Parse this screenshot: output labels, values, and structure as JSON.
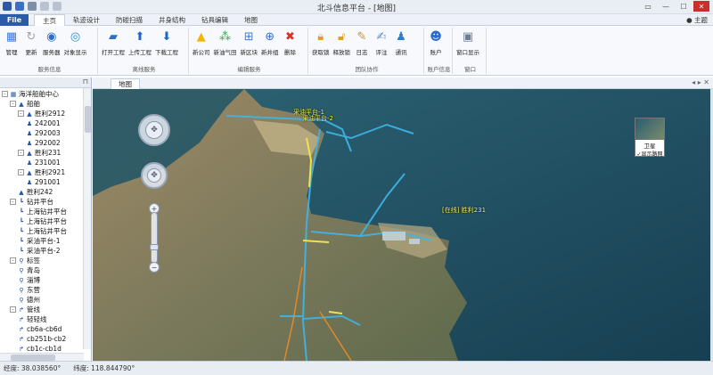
{
  "window": {
    "title": "北斗信息平台 - [地图]",
    "theme_label": "主题"
  },
  "file_tab": "File",
  "tabs": [
    "主页",
    "轨迹设计",
    "防碰扫描",
    "井身结构",
    "钻具编辑",
    "地图"
  ],
  "ribbon": {
    "groups": [
      {
        "label": "服务信息",
        "buttons": [
          "管理",
          "更新",
          "服务器",
          "对象显示"
        ]
      },
      {
        "label": "离线服务",
        "buttons": [
          "打开工程",
          "上传工程",
          "下载工程"
        ]
      },
      {
        "label": "编辑服务",
        "buttons": [
          "新公司",
          "新油气田",
          "新区块",
          "新井组",
          "删除"
        ]
      },
      {
        "label": "团队协作",
        "buttons": [
          "获取锁",
          "释放锁",
          "日志",
          "评注",
          "通讯"
        ]
      },
      {
        "label": "账户信息",
        "buttons": [
          "账户"
        ]
      },
      {
        "label": "窗口",
        "buttons": [
          "窗口显示"
        ]
      }
    ],
    "icon_colors": {
      "manage": "#3a7bd5",
      "update": "#9aa3ae",
      "server": "#2c6fc7",
      "display": "#2a8fd0",
      "open": "#2d6fc2",
      "upload": "#1f67c6",
      "download": "#1f67c6",
      "company": "#f4b400",
      "oilfield": "#2fa84f",
      "block": "#3b7dd8",
      "wellgroup": "#3b6fc4",
      "delete": "#d9302c",
      "lock": "#e1a21a",
      "unlock": "#e1a21a",
      "log": "#c8943a",
      "comment": "#5a8fd6",
      "comm": "#2a7fd4",
      "account": "#2b6ac9",
      "window": "#6c7d94"
    }
  },
  "tree": {
    "nodes": [
      {
        "label": "海洋船舶中心",
        "level": 0,
        "exp": "-",
        "icon": "grid"
      },
      {
        "label": "船舶",
        "level": 1,
        "exp": "-",
        "icon": "ship"
      },
      {
        "label": "胜利2912",
        "level": 2,
        "exp": "-",
        "icon": "ship"
      },
      {
        "label": "242001",
        "level": 3,
        "exp": "",
        "icon": "crew"
      },
      {
        "label": "292003",
        "level": 3,
        "exp": "",
        "icon": "crew"
      },
      {
        "label": "292002",
        "level": 3,
        "exp": "",
        "icon": "crew"
      },
      {
        "label": "胜利231",
        "level": 2,
        "exp": "-",
        "icon": "ship"
      },
      {
        "label": "231001",
        "level": 3,
        "exp": "",
        "icon": "crew"
      },
      {
        "label": "胜利2921",
        "level": 2,
        "exp": "-",
        "icon": "ship"
      },
      {
        "label": "291001",
        "level": 3,
        "exp": "",
        "icon": "crew"
      },
      {
        "label": "胜利242",
        "level": 2,
        "exp": "",
        "icon": "ship"
      },
      {
        "label": "钻井平台",
        "level": 1,
        "exp": "-",
        "icon": "rig"
      },
      {
        "label": "上海钻井平台",
        "level": 2,
        "exp": "",
        "icon": "rig"
      },
      {
        "label": "上海钻井平台",
        "level": 2,
        "exp": "",
        "icon": "rig"
      },
      {
        "label": "上海钻井平台",
        "level": 2,
        "exp": "",
        "icon": "rig"
      },
      {
        "label": "采油平台-1",
        "level": 2,
        "exp": "",
        "icon": "rig"
      },
      {
        "label": "采油平台-2",
        "level": 2,
        "exp": "",
        "icon": "rig"
      },
      {
        "label": "标签",
        "level": 1,
        "exp": "-",
        "icon": "pin"
      },
      {
        "label": "青岛",
        "level": 2,
        "exp": "",
        "icon": "pin"
      },
      {
        "label": "淄博",
        "level": 2,
        "exp": "",
        "icon": "pin"
      },
      {
        "label": "东营",
        "level": 2,
        "exp": "",
        "icon": "pin"
      },
      {
        "label": "德州",
        "level": 2,
        "exp": "",
        "icon": "pin"
      },
      {
        "label": "管线",
        "level": 1,
        "exp": "-",
        "icon": "pipe"
      },
      {
        "label": "轻轻线",
        "level": 2,
        "exp": "",
        "icon": "pipe"
      },
      {
        "label": "cb6a-cb6d",
        "level": 2,
        "exp": "",
        "icon": "pipe"
      },
      {
        "label": "cb251b-cb2",
        "level": 2,
        "exp": "",
        "icon": "pipe"
      },
      {
        "label": "cb1c-cb1d",
        "level": 2,
        "exp": "",
        "icon": "pipe"
      }
    ]
  },
  "doc_tab": "地图",
  "map": {
    "labels": [
      "采油平台-1",
      "采油平台-2",
      "[在线] 胜利231"
    ],
    "minimap_title": "卫星",
    "minimap_option": "✓显示路网"
  },
  "status": {
    "longitude": "经度: 38.038560°",
    "latitude": "纬度: 118.844790°"
  }
}
